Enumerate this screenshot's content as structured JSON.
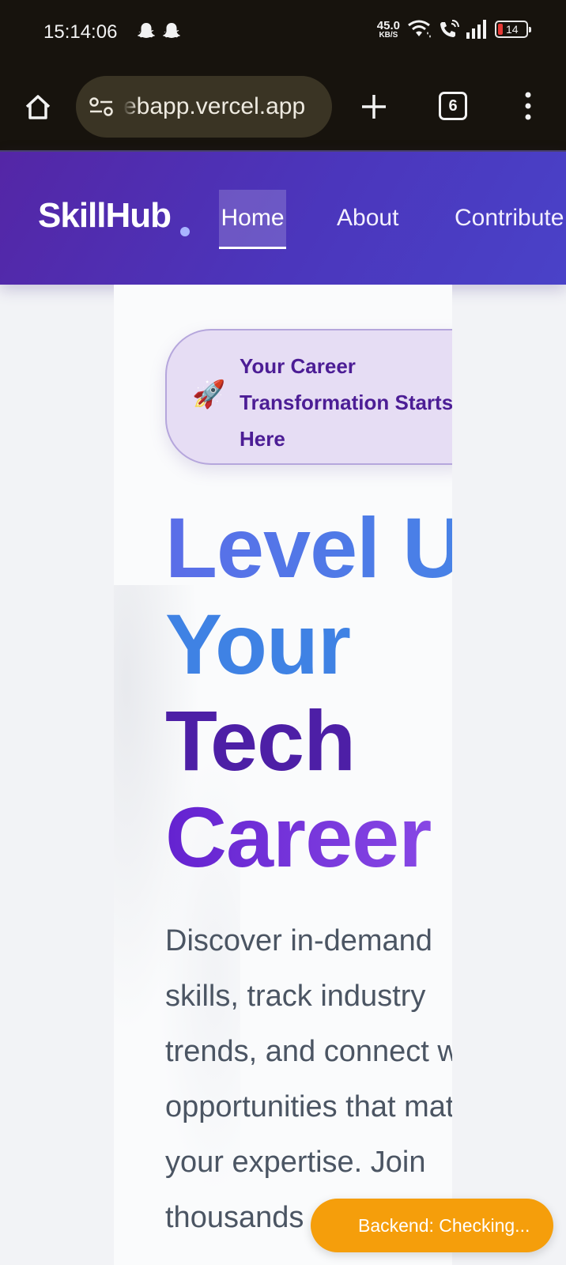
{
  "status_bar": {
    "time": "15:14:06",
    "net_speed_value": "45.0",
    "net_speed_unit": "KB/S",
    "battery_level": "14",
    "icons": [
      "snapchat-ghost-icon",
      "snapchat-ghost-icon",
      "wifi-icon",
      "wifi-calling-icon",
      "signal-icon",
      "battery-icon"
    ]
  },
  "browser": {
    "url": "ebapp.vercel.app",
    "tab_count": "6",
    "icons": [
      "home-icon",
      "site-settings-icon",
      "new-tab-icon",
      "tab-switcher-icon",
      "menu-icon"
    ]
  },
  "header": {
    "logo": "SkillHub",
    "nav": [
      {
        "label": "Home",
        "active": true
      },
      {
        "label": "About",
        "active": false
      },
      {
        "label": "Contribute",
        "active": false
      }
    ]
  },
  "hero": {
    "badge_icon": "🚀",
    "badge_text": "Your Career\nTransformation Starts\nHere",
    "title_lines": [
      "Level Up",
      "Your",
      "Tech",
      "Career"
    ],
    "description": "Discover in-demand\nskills, track industry\ntrends, and connect with\nopportunities that match\nyour expertise. Join\nthousands"
  },
  "backend_status": "Backend: Checking...",
  "colors": {
    "header_start": "#5426a6",
    "header_end": "#4a42c8",
    "badge_bg": "#e6ddf4",
    "badge_text": "#4c1d95",
    "title_blue": "#3f82e4",
    "title_purple": "#4d1fa6",
    "backend_pill": "#f59e0b"
  }
}
